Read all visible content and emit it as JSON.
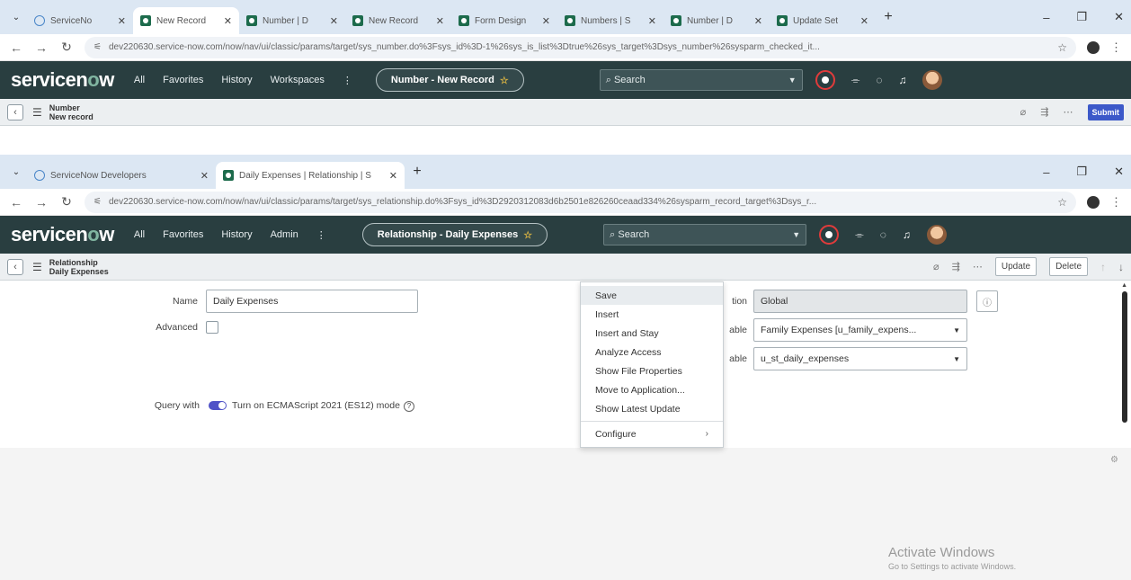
{
  "win1": {
    "tabs": [
      {
        "label": "ServiceNo",
        "icon": "globe-icon",
        "active": false
      },
      {
        "label": "New Record",
        "icon": "servicenow-icon",
        "active": true
      },
      {
        "label": "Number | D",
        "icon": "servicenow-icon",
        "active": false
      },
      {
        "label": "New Record",
        "icon": "servicenow-icon",
        "active": false
      },
      {
        "label": "Form Design",
        "icon": "servicenow-icon",
        "active": false
      },
      {
        "label": "Numbers | S",
        "icon": "servicenow-icon",
        "active": false
      },
      {
        "label": "Number | D",
        "icon": "servicenow-icon",
        "active": false
      },
      {
        "label": "Update Set",
        "icon": "servicenow-icon",
        "active": false
      }
    ],
    "url": "dev220630.service-now.com/now/nav/ui/classic/params/target/sys_number.do%3Fsys_id%3D-1%26sys_is_list%3Dtrue%26sys_target%3Dsys_number%26sysparm_checked_it...",
    "nav": {
      "all": "All",
      "favorites": "Favorites",
      "history": "History",
      "workspaces": "Workspaces"
    },
    "pill": "Number - New Record",
    "search_placeholder": "Search",
    "form": {
      "title1": "Number",
      "title2": "New record",
      "submit": "Submit"
    }
  },
  "win2": {
    "tabs": [
      {
        "label": "ServiceNow Developers",
        "icon": "globe-icon",
        "active": false
      },
      {
        "label": "Daily Expenses | Relationship | S",
        "icon": "servicenow-icon",
        "active": true
      }
    ],
    "url": "dev220630.service-now.com/now/nav/ui/classic/params/target/sys_relationship.do%3Fsys_id%3D2920312083d6b2501e826260ceaad334%26sysparm_record_target%3Dsys_r...",
    "nav": {
      "all": "All",
      "favorites": "Favorites",
      "history": "History",
      "admin": "Admin"
    },
    "pill": "Relationship - Daily Expenses",
    "search_placeholder": "Search",
    "form": {
      "title1": "Relationship",
      "title2": "Daily Expenses",
      "update": "Update",
      "delete": "Delete",
      "fields": {
        "name_label": "Name",
        "name_value": "Daily Expenses",
        "advanced_label": "Advanced",
        "query_label": "Query with",
        "ecma_text": "Turn on ECMAScript 2021 (ES12) mode",
        "application_label": "tion",
        "application_value": "Global",
        "applies_label": "able",
        "applies_value": "Family Expenses [u_family_expens...",
        "queries_label": "able",
        "queries_value": "u_st_daily_expenses"
      }
    }
  },
  "context_menu": {
    "items": [
      "Save",
      "Insert",
      "Insert and Stay",
      "Analyze Access",
      "Show File Properties",
      "Move to Application...",
      "Show Latest Update"
    ],
    "configure": "Configure"
  },
  "watermark": {
    "line1": "Activate Windows",
    "line2": "Go to Settings to activate Windows."
  }
}
